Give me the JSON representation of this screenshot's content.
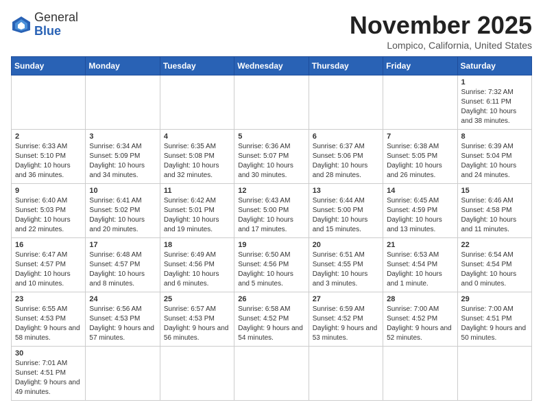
{
  "header": {
    "logo_general": "General",
    "logo_blue": "Blue",
    "title": "November 2025",
    "subtitle": "Lompico, California, United States"
  },
  "days_of_week": [
    "Sunday",
    "Monday",
    "Tuesday",
    "Wednesday",
    "Thursday",
    "Friday",
    "Saturday"
  ],
  "weeks": [
    [
      {
        "day": "",
        "info": ""
      },
      {
        "day": "",
        "info": ""
      },
      {
        "day": "",
        "info": ""
      },
      {
        "day": "",
        "info": ""
      },
      {
        "day": "",
        "info": ""
      },
      {
        "day": "",
        "info": ""
      },
      {
        "day": "1",
        "info": "Sunrise: 7:32 AM\nSunset: 6:11 PM\nDaylight: 10 hours and 38 minutes."
      }
    ],
    [
      {
        "day": "2",
        "info": "Sunrise: 6:33 AM\nSunset: 5:10 PM\nDaylight: 10 hours and 36 minutes."
      },
      {
        "day": "3",
        "info": "Sunrise: 6:34 AM\nSunset: 5:09 PM\nDaylight: 10 hours and 34 minutes."
      },
      {
        "day": "4",
        "info": "Sunrise: 6:35 AM\nSunset: 5:08 PM\nDaylight: 10 hours and 32 minutes."
      },
      {
        "day": "5",
        "info": "Sunrise: 6:36 AM\nSunset: 5:07 PM\nDaylight: 10 hours and 30 minutes."
      },
      {
        "day": "6",
        "info": "Sunrise: 6:37 AM\nSunset: 5:06 PM\nDaylight: 10 hours and 28 minutes."
      },
      {
        "day": "7",
        "info": "Sunrise: 6:38 AM\nSunset: 5:05 PM\nDaylight: 10 hours and 26 minutes."
      },
      {
        "day": "8",
        "info": "Sunrise: 6:39 AM\nSunset: 5:04 PM\nDaylight: 10 hours and 24 minutes."
      }
    ],
    [
      {
        "day": "9",
        "info": "Sunrise: 6:40 AM\nSunset: 5:03 PM\nDaylight: 10 hours and 22 minutes."
      },
      {
        "day": "10",
        "info": "Sunrise: 6:41 AM\nSunset: 5:02 PM\nDaylight: 10 hours and 20 minutes."
      },
      {
        "day": "11",
        "info": "Sunrise: 6:42 AM\nSunset: 5:01 PM\nDaylight: 10 hours and 19 minutes."
      },
      {
        "day": "12",
        "info": "Sunrise: 6:43 AM\nSunset: 5:00 PM\nDaylight: 10 hours and 17 minutes."
      },
      {
        "day": "13",
        "info": "Sunrise: 6:44 AM\nSunset: 5:00 PM\nDaylight: 10 hours and 15 minutes."
      },
      {
        "day": "14",
        "info": "Sunrise: 6:45 AM\nSunset: 4:59 PM\nDaylight: 10 hours and 13 minutes."
      },
      {
        "day": "15",
        "info": "Sunrise: 6:46 AM\nSunset: 4:58 PM\nDaylight: 10 hours and 11 minutes."
      }
    ],
    [
      {
        "day": "16",
        "info": "Sunrise: 6:47 AM\nSunset: 4:57 PM\nDaylight: 10 hours and 10 minutes."
      },
      {
        "day": "17",
        "info": "Sunrise: 6:48 AM\nSunset: 4:57 PM\nDaylight: 10 hours and 8 minutes."
      },
      {
        "day": "18",
        "info": "Sunrise: 6:49 AM\nSunset: 4:56 PM\nDaylight: 10 hours and 6 minutes."
      },
      {
        "day": "19",
        "info": "Sunrise: 6:50 AM\nSunset: 4:56 PM\nDaylight: 10 hours and 5 minutes."
      },
      {
        "day": "20",
        "info": "Sunrise: 6:51 AM\nSunset: 4:55 PM\nDaylight: 10 hours and 3 minutes."
      },
      {
        "day": "21",
        "info": "Sunrise: 6:53 AM\nSunset: 4:54 PM\nDaylight: 10 hours and 1 minute."
      },
      {
        "day": "22",
        "info": "Sunrise: 6:54 AM\nSunset: 4:54 PM\nDaylight: 10 hours and 0 minutes."
      }
    ],
    [
      {
        "day": "23",
        "info": "Sunrise: 6:55 AM\nSunset: 4:53 PM\nDaylight: 9 hours and 58 minutes."
      },
      {
        "day": "24",
        "info": "Sunrise: 6:56 AM\nSunset: 4:53 PM\nDaylight: 9 hours and 57 minutes."
      },
      {
        "day": "25",
        "info": "Sunrise: 6:57 AM\nSunset: 4:53 PM\nDaylight: 9 hours and 56 minutes."
      },
      {
        "day": "26",
        "info": "Sunrise: 6:58 AM\nSunset: 4:52 PM\nDaylight: 9 hours and 54 minutes."
      },
      {
        "day": "27",
        "info": "Sunrise: 6:59 AM\nSunset: 4:52 PM\nDaylight: 9 hours and 53 minutes."
      },
      {
        "day": "28",
        "info": "Sunrise: 7:00 AM\nSunset: 4:52 PM\nDaylight: 9 hours and 52 minutes."
      },
      {
        "day": "29",
        "info": "Sunrise: 7:00 AM\nSunset: 4:51 PM\nDaylight: 9 hours and 50 minutes."
      }
    ],
    [
      {
        "day": "30",
        "info": "Sunrise: 7:01 AM\nSunset: 4:51 PM\nDaylight: 9 hours and 49 minutes."
      },
      {
        "day": "",
        "info": ""
      },
      {
        "day": "",
        "info": ""
      },
      {
        "day": "",
        "info": ""
      },
      {
        "day": "",
        "info": ""
      },
      {
        "day": "",
        "info": ""
      },
      {
        "day": "",
        "info": ""
      }
    ]
  ]
}
